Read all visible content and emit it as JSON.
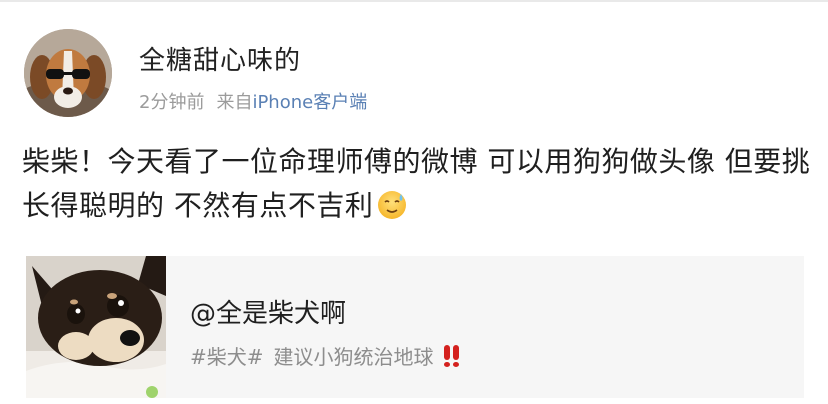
{
  "post": {
    "username": "全糖甜心味的",
    "time": "2分钟前",
    "source_prefix": "来自",
    "source_name": "iPhone客户端",
    "content": "柴柴！今天看了一位命理师傅的微博 可以用狗狗做头像 但要挑长得聪明的 不然有点不吉利",
    "emoji": "sweat-smile-emoji"
  },
  "card": {
    "title": "@全是柴犬啊",
    "hashtag": "#柴犬#",
    "desc": "建议小狗统治地球",
    "badge_icon": "double-exclamation-icon"
  },
  "colors": {
    "username": "#222222",
    "meta": "#9b9b9b",
    "source_link": "#5a80b4",
    "card_background": "#f6f6f6",
    "exclamation": "#d4211e"
  }
}
